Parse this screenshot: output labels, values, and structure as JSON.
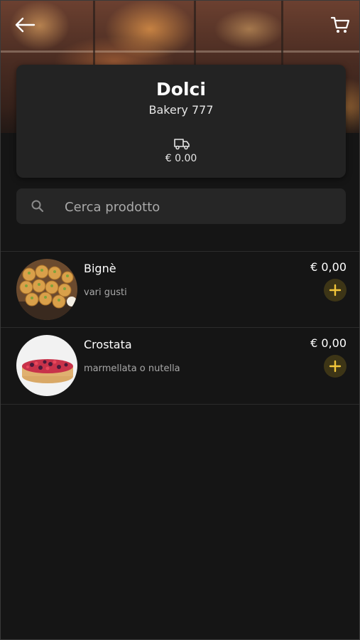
{
  "header": {
    "back_icon": "arrow-left-icon",
    "cart_icon": "shopping-cart-icon"
  },
  "store": {
    "title": "Dolci",
    "subtitle": "Bakery 777",
    "delivery_icon": "truck-icon",
    "delivery_fee": "€ 0.00"
  },
  "search": {
    "placeholder": "Cerca prodotto",
    "value": ""
  },
  "products": [
    {
      "name": "Bignè",
      "description": "vari gusti",
      "price": "€ 0,00",
      "add_icon": "plus-icon"
    },
    {
      "name": "Crostata",
      "description": "marmellata o nutella",
      "price": "€ 0,00",
      "add_icon": "plus-icon"
    }
  ],
  "colors": {
    "background": "#151515",
    "card": "#232323",
    "accent": "#f2c63a",
    "add_button_bg": "#3d3516"
  }
}
